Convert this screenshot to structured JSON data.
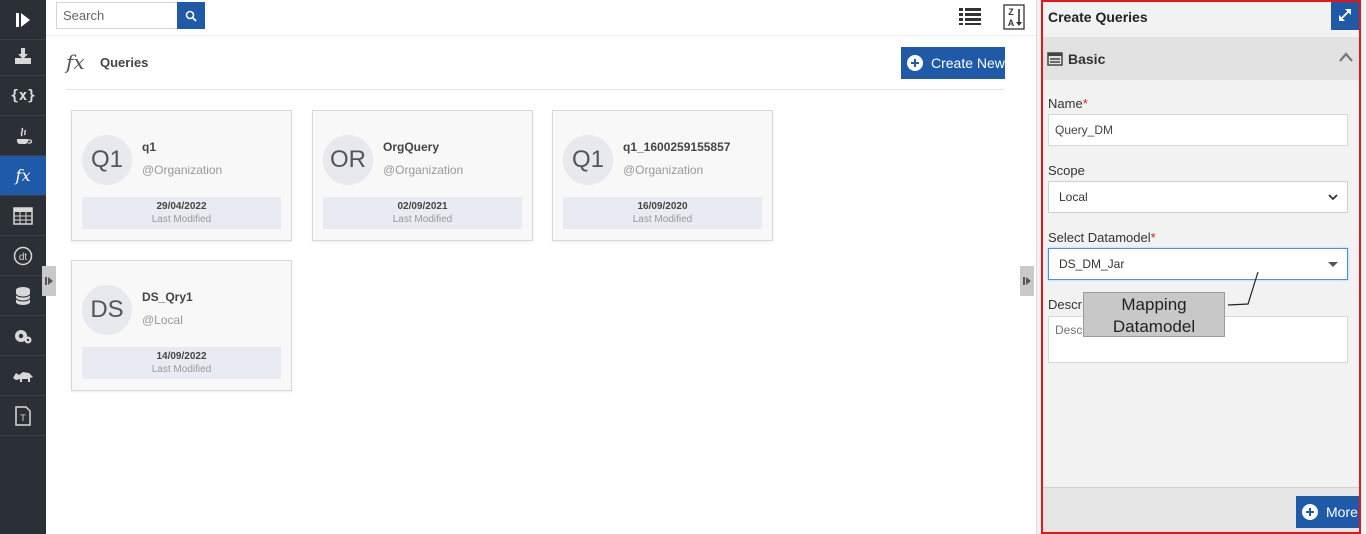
{
  "rail": {
    "items": [
      {
        "icon": "collapse-panel-icon"
      },
      {
        "icon": "import-icon"
      },
      {
        "icon": "variable-icon",
        "glyph": "{x}"
      },
      {
        "icon": "java-icon"
      },
      {
        "icon": "function-icon",
        "glyph": "fx",
        "active": true
      },
      {
        "icon": "table-icon"
      },
      {
        "icon": "dt-icon"
      },
      {
        "icon": "database-icon"
      },
      {
        "icon": "settings-icon"
      },
      {
        "icon": "rhino-icon"
      },
      {
        "icon": "text-file-icon"
      }
    ]
  },
  "search": {
    "placeholder": "Search"
  },
  "page": {
    "title": "Queries",
    "create_new_label": "Create New"
  },
  "cards": [
    {
      "initials": "Q1",
      "name": "q1",
      "scope": "@Organization",
      "date": "29/04/2022",
      "sub": "Last Modified"
    },
    {
      "initials": "OR",
      "name": "OrgQuery",
      "scope": "@Organization",
      "date": "02/09/2021",
      "sub": "Last Modified"
    },
    {
      "initials": "Q1",
      "name": "q1_1600259155857",
      "scope": "@Organization",
      "date": "16/09/2020",
      "sub": "Last Modified"
    },
    {
      "initials": "DS",
      "name": "DS_Qry1",
      "scope": "@Local",
      "date": "14/09/2022",
      "sub": "Last Modified"
    }
  ],
  "panel": {
    "title": "Create Queries",
    "section_title": "Basic",
    "name_label": "Name",
    "name_value": "Query_DM",
    "scope_label": "Scope",
    "scope_value": "Local",
    "datamodel_label": "Select Datamodel",
    "datamodel_value": "DS_DM_Jar",
    "description_label": "Descr",
    "description_placeholder": "Desc",
    "more_label": "More"
  },
  "annotation": {
    "line1": "Mapping",
    "line2": "Datamodel"
  },
  "colors": {
    "accent": "#1f5aa8",
    "rail": "#2b2f36",
    "required": "#cc2222",
    "highlight_frame": "#e01818"
  }
}
